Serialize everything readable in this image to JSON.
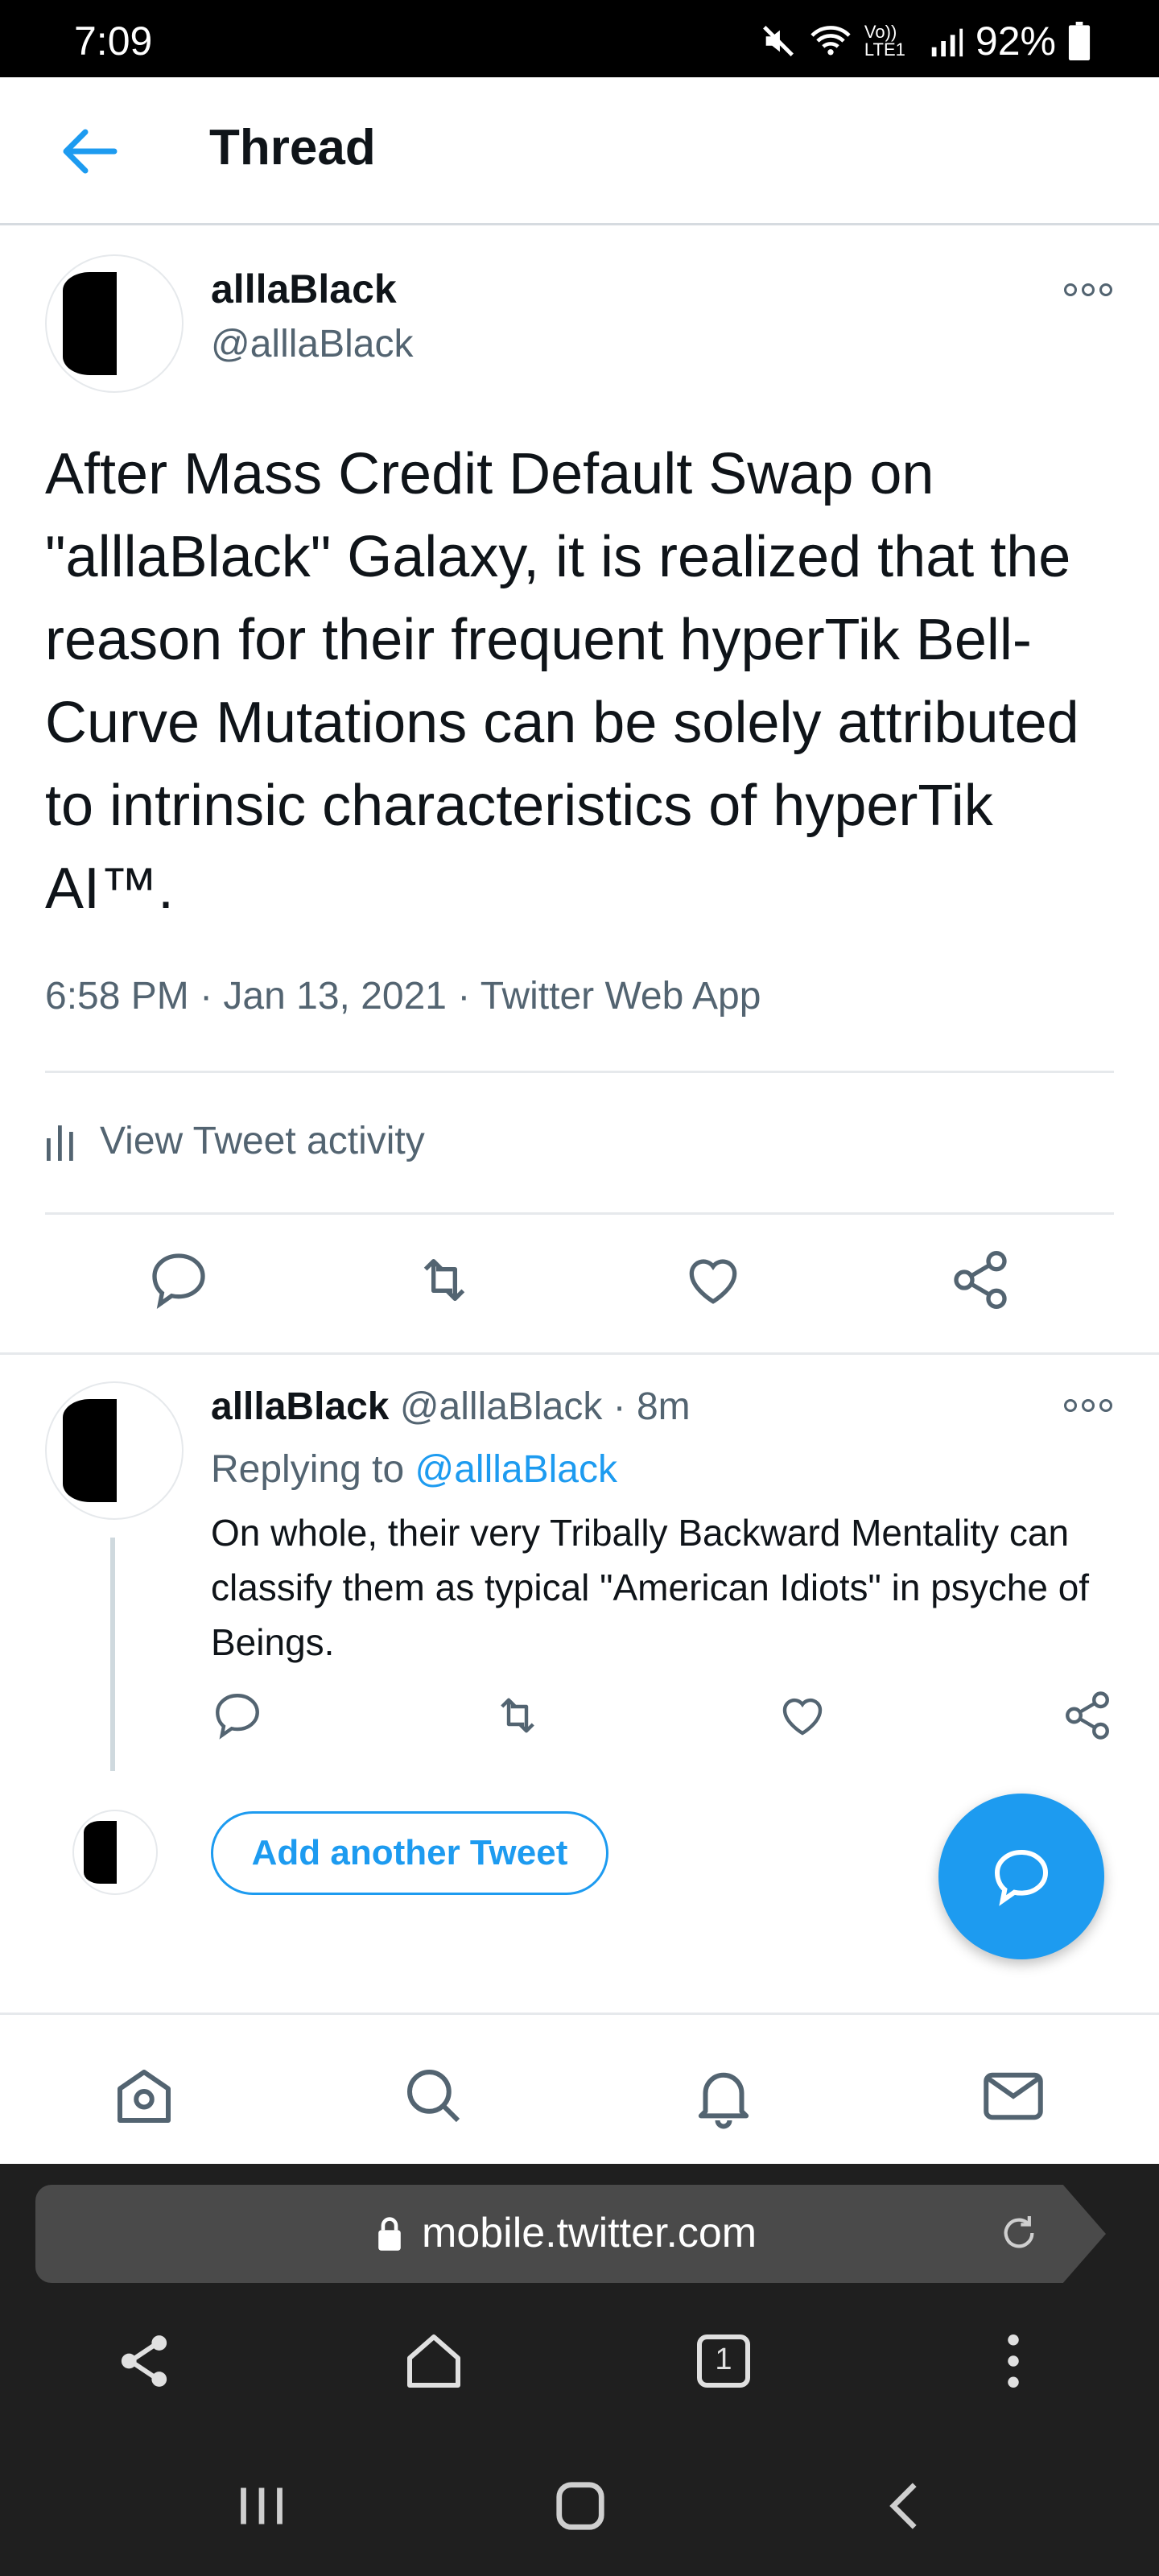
{
  "status_bar": {
    "time": "7:09",
    "battery": "92%",
    "network": "Vo)) LTE1"
  },
  "header": {
    "title": "Thread"
  },
  "main_tweet": {
    "name": "alllaBlack",
    "handle": "@alllaBlack",
    "text": "After Mass Credit Default Swap on \"alllaBlack\" Galaxy, it is realized that the reason for their frequent hyperTik Bell-Curve Mutations can be solely attributed to intrinsic characteristics of hyperTik AI™.",
    "timestamp": "6:58 PM · Jan 13, 2021 · Twitter Web App",
    "activity_label": "View Tweet activity"
  },
  "reply_tweet": {
    "name": "alllaBlack",
    "handle": "@alllaBlack",
    "time": "· 8m",
    "replying_prefix": "Replying to ",
    "replying_to": "@alllaBlack",
    "text": "On whole, their very Tribally Backward Mentality can classify them as typical \"American Idiots\" in psyche of Beings."
  },
  "compose": {
    "add_label": "Add another Tweet"
  },
  "browser": {
    "url": "mobile.twitter.com",
    "tab_count": "1"
  },
  "colors": {
    "accent": "#1d9bf0",
    "secondary_text": "#536471"
  },
  "icons": [
    "back-arrow-icon",
    "more-icon",
    "reply-icon",
    "retweet-icon",
    "like-icon",
    "share-icon",
    "home-icon",
    "search-icon",
    "notifications-icon",
    "messages-icon",
    "compose-icon",
    "lock-icon",
    "reload-icon",
    "tabs-icon",
    "menu-icon"
  ]
}
